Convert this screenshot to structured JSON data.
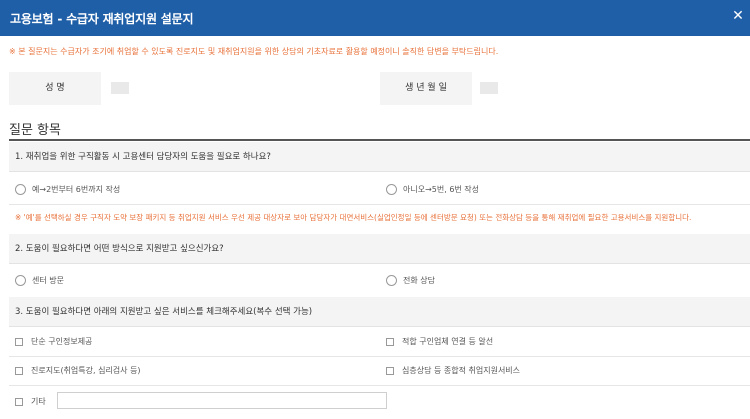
{
  "window": {
    "title": "고용보험 - 수급자 재취업지원 설문지",
    "close_icon": "close-icon"
  },
  "notice": "※ 본 질문지는 수급자가 조기에 취업할 수 있도록 진로지도 및 재취업지원을 위한 상담의 기초자료로 활용할 예정이니 솔직한 답변을 부탁드립니다.",
  "info": {
    "name_label": "성 명",
    "birth_label": "생 년 월 일"
  },
  "section_title": "질문 항목",
  "questions": [
    {
      "text": "1. 재취업을 위한 구직활동 시 고용센터 담당자의 도움을 필요로 하나요?",
      "options": [
        "예→2번부터 6번까지 작성",
        "아니오→5번, 6번 작성"
      ],
      "note": "※ '예'를 선택하실 경우 구직자 도약 보장 패키지 등 취업지원 서비스 우선 제공 대상자로 보아 담당자가 대면서비스(실업인정일 등에 센터방문 요청) 또는 전화상담 등을 통해 재취업에 필요한 고용서비스를 지원합니다."
    },
    {
      "text": "2. 도움이 필요하다면 어떤 방식으로 지원받고 싶으신가요?",
      "options": [
        "센터 방문",
        "전화 상담"
      ]
    },
    {
      "text": "3. 도움이 필요하다면 아래의 지원받고 싶은 서비스를 체크해주세요(복수 선택 가능)",
      "options": [
        "단순 구인정보제공",
        "적합 구인업체 연결 등 알선",
        "진로지도(취업특강, 심리검사 등)",
        "심층상담 등 종합적 취업지원서비스",
        "기타"
      ],
      "etc_value": ""
    }
  ],
  "colors": {
    "titlebar": "#1f5fa8",
    "notice": "#e8713a",
    "panel": "#f4f4f4"
  }
}
